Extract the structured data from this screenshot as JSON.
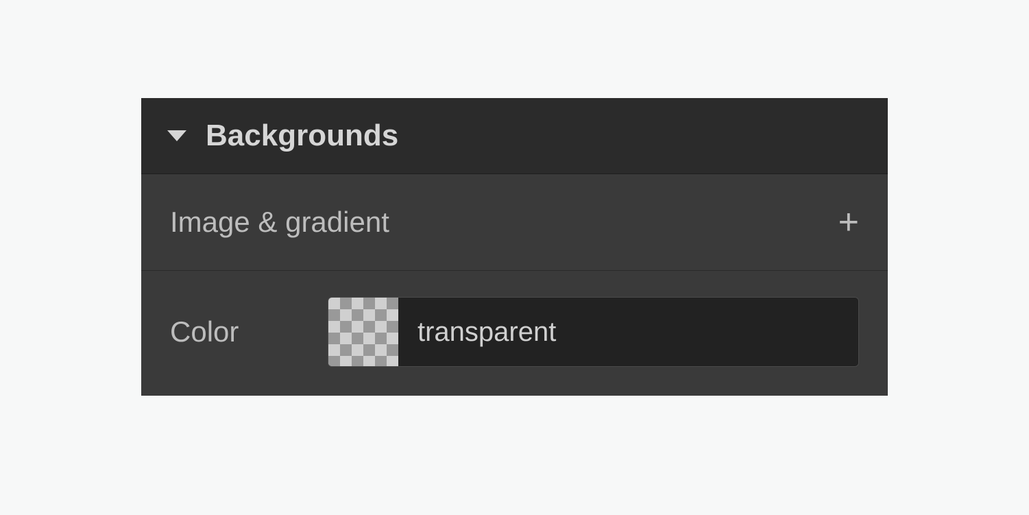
{
  "panel": {
    "title": "Backgrounds",
    "imageGradient": {
      "label": "Image & gradient"
    },
    "color": {
      "label": "Color",
      "value": "transparent"
    }
  }
}
